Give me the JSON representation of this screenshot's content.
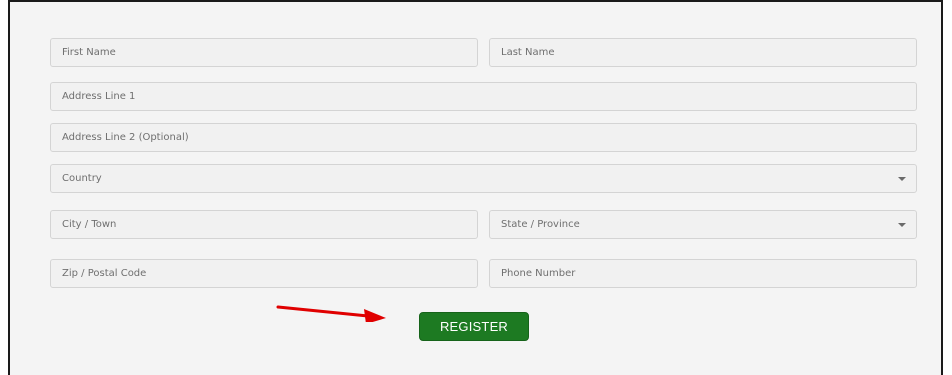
{
  "form": {
    "first_name": {
      "placeholder": "First Name",
      "value": ""
    },
    "last_name": {
      "placeholder": "Last Name",
      "value": ""
    },
    "address1": {
      "placeholder": "Address Line 1",
      "value": ""
    },
    "address2": {
      "placeholder": "Address Line 2 (Optional)",
      "value": ""
    },
    "country": {
      "selected": "Country"
    },
    "city": {
      "placeholder": "City / Town",
      "value": ""
    },
    "state": {
      "selected": "State / Province"
    },
    "zip": {
      "placeholder": "Zip / Postal Code",
      "value": ""
    },
    "phone": {
      "placeholder": "Phone Number",
      "value": ""
    },
    "register_label": "REGISTER"
  },
  "icons": {
    "dropdown": "chevron-down-icon",
    "annotation": "red-arrow-icon"
  },
  "colors": {
    "button_bg": "#1d7a22",
    "button_text": "#ffffff",
    "arrow": "#e00000",
    "field_bg": "#f1f1f1",
    "field_border": "#d4d4d4"
  }
}
